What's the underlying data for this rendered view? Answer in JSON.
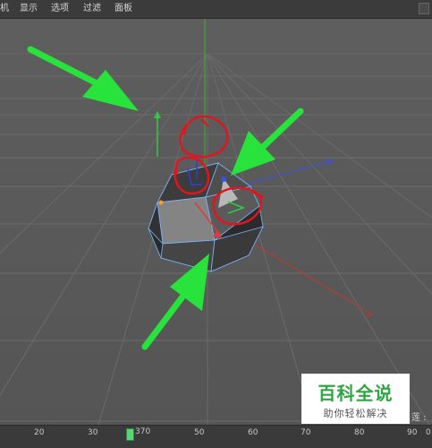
{
  "menu": [
    {
      "label": "机"
    },
    {
      "label": "显示"
    },
    {
      "label": "选项"
    },
    {
      "label": "过滤"
    },
    {
      "label": "面板"
    }
  ],
  "watermark": {
    "title": "百科全说",
    "subtitle": "助你轻松解决"
  },
  "side_tag": "莲 :",
  "timeline": {
    "ticks": [
      "20",
      "30",
      "50",
      "60",
      "70",
      "80",
      "90"
    ],
    "current_frame": "37",
    "current_frame_suffix": "0",
    "end_label": "0"
  },
  "colors": {
    "arrow": "#27e33c",
    "circle": "#e3141c",
    "x_axis": "#d0312d",
    "y_axis": "#2ecc40",
    "z_axis": "#3a52e6"
  }
}
